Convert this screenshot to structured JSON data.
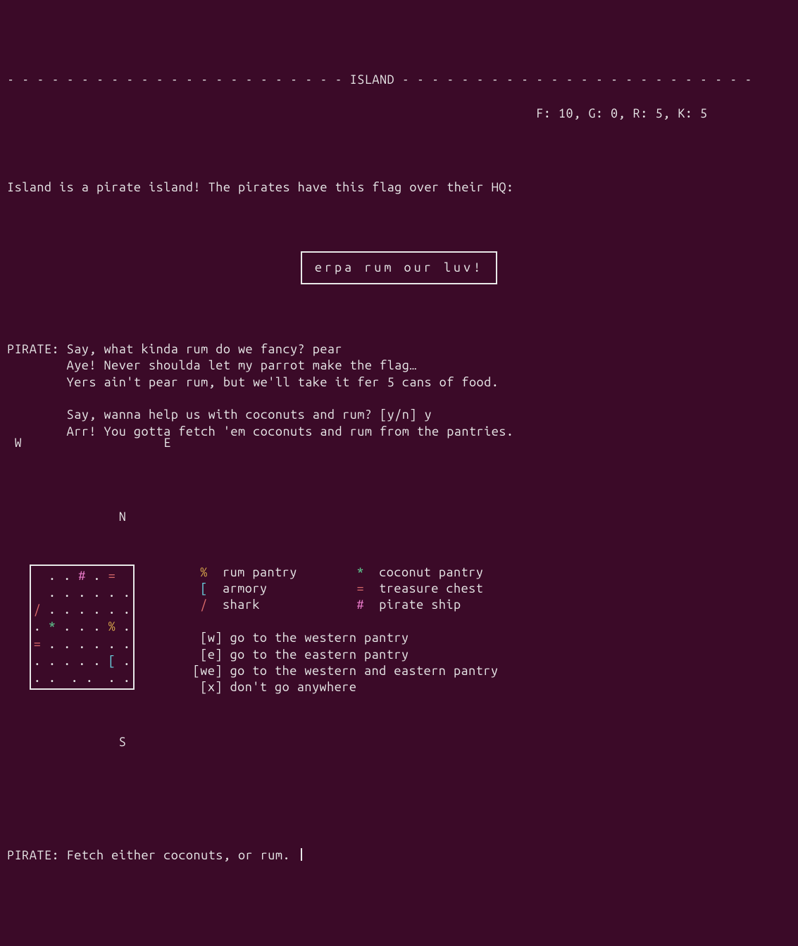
{
  "header": {
    "title_line": "- - - - - - - - - - - - - - - - - - - - - - - ISLAND - - - - - - - - - - - - - - - - - - - - - - - -",
    "stats_line": "                                                                       F: 10, G: 0, R: 5, K: 5"
  },
  "intro": "Island is a pirate island! The pirates have this flag over their HQ:",
  "flag": "erpa rum our luv!",
  "dialogue": {
    "l1": "PIRATE: Say, what kinda rum do we fancy? pear",
    "l2": "        Aye! Never shoulda let my parrot make the flag…",
    "l3": "        Yers ain't pear rum, but we'll take it fer 5 cans of food.",
    "l4": "",
    "l5": "        Say, wanna help us with coconuts and rum? [y/n] y",
    "l6": "        Arr! You gotta fetch 'em coconuts and rum from the pantries."
  },
  "compass": {
    "n": "N",
    "s": "S",
    "w": "W",
    "e": "E"
  },
  "map": {
    "r1a": "  . . ",
    "r1b": "#",
    "r1c": " . ",
    "r1d": "=",
    "r2": "  . . . . . .",
    "r3a": "/",
    "r3b": " . . . . . .",
    "r4a": ". ",
    "r4b": "*",
    "r4c": " . . . ",
    "r4d": "%",
    "r4e": " .",
    "r5a": "=",
    "r5b": " . . . . . .",
    "r6a": ". . . . . ",
    "r6b": "[",
    "r6c": " .",
    "r7": ". .  . .  . ."
  },
  "legend": {
    "l1a": "%",
    "l1b": "  rum pantry        ",
    "l1c": "*",
    "l1d": "  coconut pantry",
    "l2a": "[",
    "l2b": "  armory            ",
    "l2c": "=",
    "l2d": "  treasure chest",
    "l3a": "/",
    "l3b": "  shark             ",
    "l3c": "#",
    "l3d": "  pirate ship"
  },
  "commands": {
    "c1": " [w] go to the western pantry",
    "c2": " [e] go to the eastern pantry",
    "c3": "[we] go to the western and eastern pantry",
    "c4": " [x] don't go anywhere"
  },
  "prompt": "PIRATE: Fetch either coconuts, or rum. "
}
